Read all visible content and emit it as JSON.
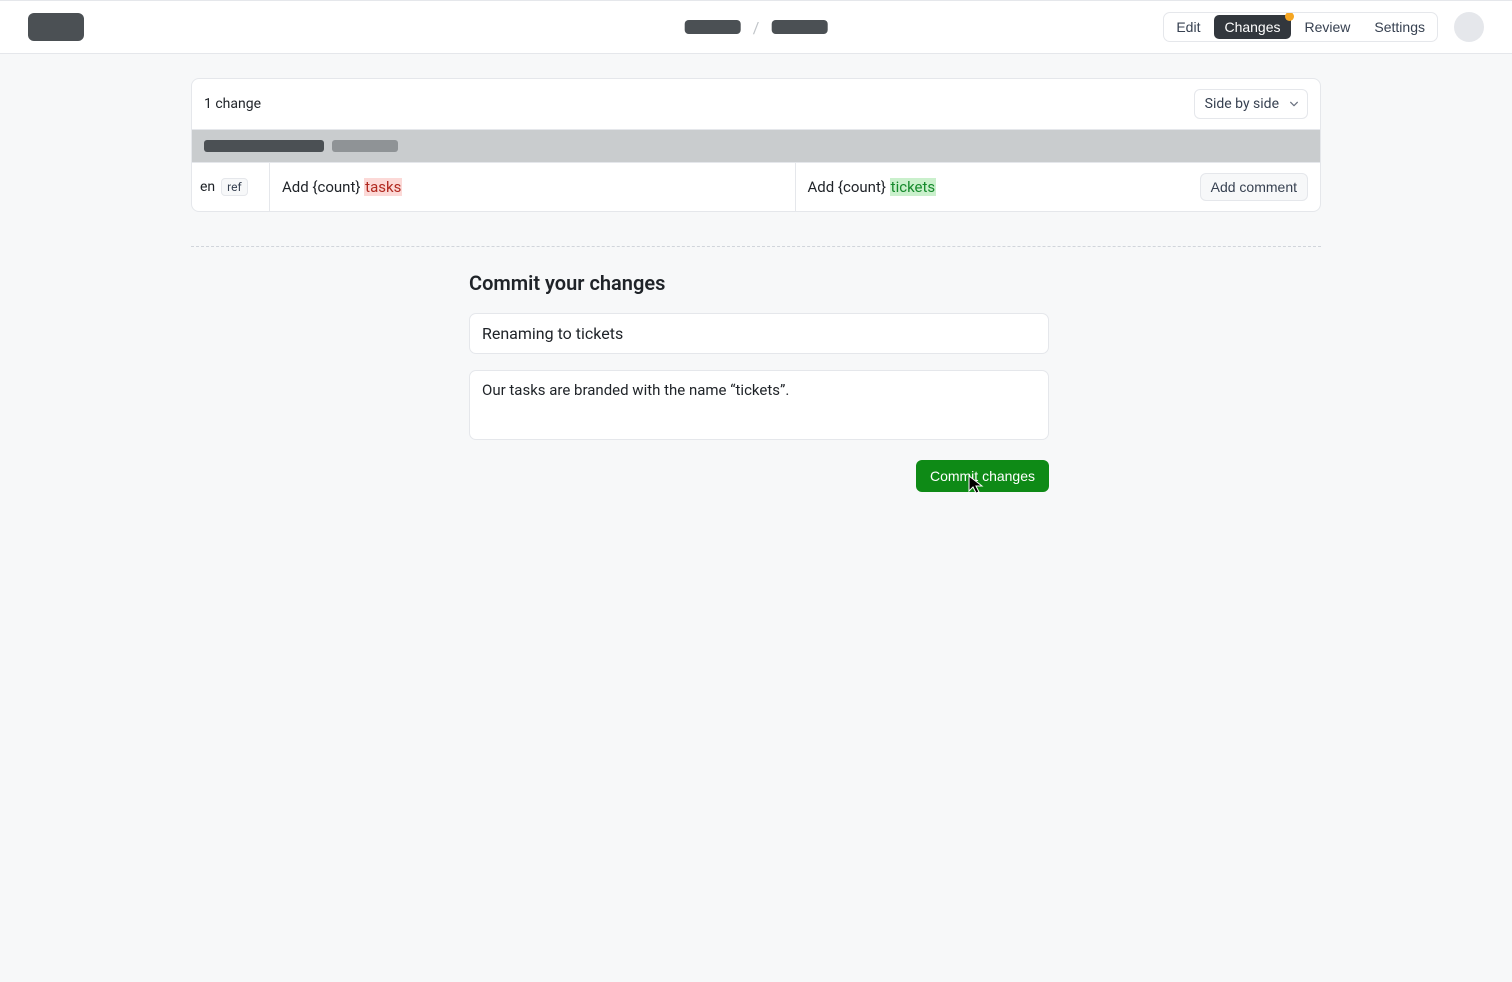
{
  "header": {
    "tabs": {
      "edit": "Edit",
      "changes": "Changes",
      "review": "Review",
      "settings": "Settings"
    }
  },
  "changes": {
    "count_label": "1 change",
    "view_mode": "Side by side",
    "diff": {
      "lang": "en",
      "ref_label": "ref",
      "old_prefix": "Add {count} ",
      "old_removed": "tasks",
      "new_prefix": "Add {count} ",
      "new_added": "tickets"
    },
    "add_comment_label": "Add comment"
  },
  "commit": {
    "heading": "Commit your changes",
    "summary": "Renaming to tickets",
    "description": "Our tasks are branded with the name “tickets”.",
    "button_label": "Commit changes"
  }
}
